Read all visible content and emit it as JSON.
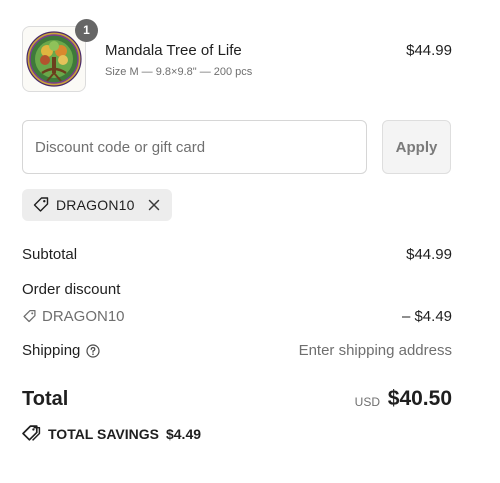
{
  "product": {
    "name": "Mandala Tree of Life",
    "variant": "Size M — 9.8×9.8\" — 200 pcs",
    "price": "$44.99",
    "quantity": "1",
    "image_icon": "tree-of-life-mandala-puzzle-image"
  },
  "discount_form": {
    "placeholder": "Discount code or gift card",
    "value": "",
    "apply_label": "Apply"
  },
  "applied_code": {
    "code": "DRAGON10",
    "tag_icon": "tag-icon",
    "remove_icon": "close-icon"
  },
  "summary": {
    "subtotal_label": "Subtotal",
    "subtotal_value": "$44.99",
    "order_discount_label": "Order discount",
    "discount_code": "DRAGON10",
    "discount_value": "– $4.49",
    "shipping_label": "Shipping",
    "shipping_value": "Enter shipping address",
    "shipping_help_icon": "help-circle-icon"
  },
  "total": {
    "label": "Total",
    "currency": "USD",
    "amount": "$40.50"
  },
  "savings": {
    "label": "TOTAL SAVINGS",
    "amount": "$4.49"
  },
  "colors": {
    "badge": "#666666",
    "chip_background": "#ededed",
    "apply_background": "#f4f4f4",
    "muted_text": "#6f6f6f"
  }
}
